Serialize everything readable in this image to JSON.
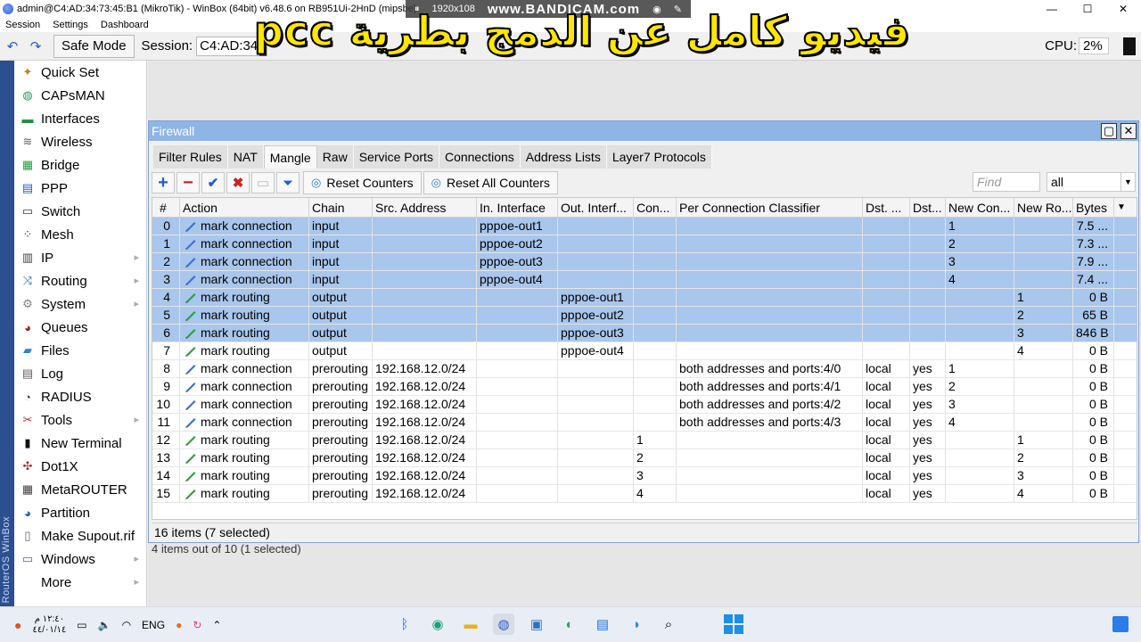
{
  "window": {
    "title": "admin@C4:AD:34:73:45:B1 (MikroTik) - WinBox (64bit) v6.48.6 on RB951Ui-2HnD (mipsbe)",
    "recorder_res": "1920x108",
    "recorder_brand": "www.BANDICAM.com",
    "controls": [
      "—",
      "☐",
      "✕"
    ]
  },
  "menu": [
    "Session",
    "Settings",
    "Dashboard"
  ],
  "toolbar": {
    "safe_mode": "Safe Mode",
    "session_label": "Session:",
    "session_value": "C4:AD:34",
    "cpu_label": "CPU:",
    "cpu_value": "2%"
  },
  "overlay_text": "فيديو كامل عن الدمج بطرية pcc",
  "routeros_label": "RouterOS WinBox",
  "sidebar": [
    {
      "label": "Quick Set",
      "icon": "wand-icon"
    },
    {
      "label": "CAPsMAN",
      "icon": "capsman-icon"
    },
    {
      "label": "Interfaces",
      "icon": "interfaces-icon"
    },
    {
      "label": "Wireless",
      "icon": "wireless-icon"
    },
    {
      "label": "Bridge",
      "icon": "bridge-icon"
    },
    {
      "label": "PPP",
      "icon": "ppp-icon"
    },
    {
      "label": "Switch",
      "icon": "switch-icon"
    },
    {
      "label": "Mesh",
      "icon": "mesh-icon"
    },
    {
      "label": "IP",
      "icon": "ip-icon",
      "submenu": true
    },
    {
      "label": "Routing",
      "icon": "routing-icon",
      "submenu": true
    },
    {
      "label": "System",
      "icon": "gear-icon",
      "submenu": true
    },
    {
      "label": "Queues",
      "icon": "queues-icon"
    },
    {
      "label": "Files",
      "icon": "folder-icon"
    },
    {
      "label": "Log",
      "icon": "log-icon"
    },
    {
      "label": "RADIUS",
      "icon": "radius-icon"
    },
    {
      "label": "Tools",
      "icon": "tools-icon",
      "submenu": true
    },
    {
      "label": "New Terminal",
      "icon": "terminal-icon"
    },
    {
      "label": "Dot1X",
      "icon": "dot1x-icon"
    },
    {
      "label": "MetaROUTER",
      "icon": "metarouter-icon"
    },
    {
      "label": "Partition",
      "icon": "partition-icon"
    },
    {
      "label": "Make Supout.rif",
      "icon": "supout-icon"
    },
    {
      "label": "Windows",
      "icon": "windows-icon",
      "submenu": true
    },
    {
      "label": "More",
      "icon": "",
      "submenu": true
    }
  ],
  "firewall": {
    "title": "Firewall",
    "tabs": [
      "Filter Rules",
      "NAT",
      "Mangle",
      "Raw",
      "Service Ports",
      "Connections",
      "Address Lists",
      "Layer7 Protocols"
    ],
    "active_tab": "Mangle",
    "reset_counters": "Reset Counters",
    "reset_all_counters": "Reset All Counters",
    "find_placeholder": "Find",
    "filter_value": "all",
    "columns": [
      "#",
      "Action",
      "Chain",
      "Src. Address",
      "In. Interface",
      "Out. Interf...",
      "Con...",
      "Per Connection Classifier",
      "Dst. ...",
      "Dst...",
      "New Con...",
      "New Ro...",
      "Bytes"
    ],
    "rows": [
      {
        "n": "0",
        "action": "mark connection",
        "chain": "input",
        "src": "",
        "in": "pppoe-out1",
        "out": "",
        "con": "",
        "pcc": "",
        "dst1": "",
        "dst2": "",
        "newcon": "1",
        "newro": "",
        "bytes": "7.5 ...",
        "selected": true
      },
      {
        "n": "1",
        "action": "mark connection",
        "chain": "input",
        "src": "",
        "in": "pppoe-out2",
        "out": "",
        "con": "",
        "pcc": "",
        "dst1": "",
        "dst2": "",
        "newcon": "2",
        "newro": "",
        "bytes": "7.3 ...",
        "selected": true
      },
      {
        "n": "2",
        "action": "mark connection",
        "chain": "input",
        "src": "",
        "in": "pppoe-out3",
        "out": "",
        "con": "",
        "pcc": "",
        "dst1": "",
        "dst2": "",
        "newcon": "3",
        "newro": "",
        "bytes": "7.9 ...",
        "selected": true
      },
      {
        "n": "3",
        "action": "mark connection",
        "chain": "input",
        "src": "",
        "in": "pppoe-out4",
        "out": "",
        "con": "",
        "pcc": "",
        "dst1": "",
        "dst2": "",
        "newcon": "4",
        "newro": "",
        "bytes": "7.4 ...",
        "selected": true
      },
      {
        "n": "4",
        "action": "mark routing",
        "chain": "output",
        "src": "",
        "in": "",
        "out": "pppoe-out1",
        "con": "",
        "pcc": "",
        "dst1": "",
        "dst2": "",
        "newcon": "",
        "newro": "1",
        "bytes": "0 B",
        "selected": true
      },
      {
        "n": "5",
        "action": "mark routing",
        "chain": "output",
        "src": "",
        "in": "",
        "out": "pppoe-out2",
        "con": "",
        "pcc": "",
        "dst1": "",
        "dst2": "",
        "newcon": "",
        "newro": "2",
        "bytes": "65 B",
        "selected": true
      },
      {
        "n": "6",
        "action": "mark routing",
        "chain": "output",
        "src": "",
        "in": "",
        "out": "pppoe-out3",
        "con": "",
        "pcc": "",
        "dst1": "",
        "dst2": "",
        "newcon": "",
        "newro": "3",
        "bytes": "846 B",
        "selected": true
      },
      {
        "n": "7",
        "action": "mark routing",
        "chain": "output",
        "src": "",
        "in": "",
        "out": "pppoe-out4",
        "con": "",
        "pcc": "",
        "dst1": "",
        "dst2": "",
        "newcon": "",
        "newro": "4",
        "bytes": "0 B",
        "selected": false
      },
      {
        "n": "8",
        "action": "mark connection",
        "chain": "prerouting",
        "src": "192.168.12.0/24",
        "in": "",
        "out": "",
        "con": "",
        "pcc": "both addresses and ports:4/0",
        "dst1": "local",
        "dst2": "yes",
        "newcon": "1",
        "newro": "",
        "bytes": "0 B",
        "selected": false
      },
      {
        "n": "9",
        "action": "mark connection",
        "chain": "prerouting",
        "src": "192.168.12.0/24",
        "in": "",
        "out": "",
        "con": "",
        "pcc": "both addresses and ports:4/1",
        "dst1": "local",
        "dst2": "yes",
        "newcon": "2",
        "newro": "",
        "bytes": "0 B",
        "selected": false
      },
      {
        "n": "10",
        "action": "mark connection",
        "chain": "prerouting",
        "src": "192.168.12.0/24",
        "in": "",
        "out": "",
        "con": "",
        "pcc": "both addresses and ports:4/2",
        "dst1": "local",
        "dst2": "yes",
        "newcon": "3",
        "newro": "",
        "bytes": "0 B",
        "selected": false
      },
      {
        "n": "11",
        "action": "mark connection",
        "chain": "prerouting",
        "src": "192.168.12.0/24",
        "in": "",
        "out": "",
        "con": "",
        "pcc": "both addresses and ports:4/3",
        "dst1": "local",
        "dst2": "yes",
        "newcon": "4",
        "newro": "",
        "bytes": "0 B",
        "selected": false
      },
      {
        "n": "12",
        "action": "mark routing",
        "chain": "prerouting",
        "src": "192.168.12.0/24",
        "in": "",
        "out": "",
        "con": "1",
        "pcc": "",
        "dst1": "local",
        "dst2": "yes",
        "newcon": "",
        "newro": "1",
        "bytes": "0 B",
        "selected": false
      },
      {
        "n": "13",
        "action": "mark routing",
        "chain": "prerouting",
        "src": "192.168.12.0/24",
        "in": "",
        "out": "",
        "con": "2",
        "pcc": "",
        "dst1": "local",
        "dst2": "yes",
        "newcon": "",
        "newro": "2",
        "bytes": "0 B",
        "selected": false
      },
      {
        "n": "14",
        "action": "mark routing",
        "chain": "prerouting",
        "src": "192.168.12.0/24",
        "in": "",
        "out": "",
        "con": "3",
        "pcc": "",
        "dst1": "local",
        "dst2": "yes",
        "newcon": "",
        "newro": "3",
        "bytes": "0 B",
        "selected": false
      },
      {
        "n": "15",
        "action": "mark routing",
        "chain": "prerouting",
        "src": "192.168.12.0/24",
        "in": "",
        "out": "",
        "con": "4",
        "pcc": "",
        "dst1": "local",
        "dst2": "yes",
        "newcon": "",
        "newro": "4",
        "bytes": "0 B",
        "selected": false
      }
    ],
    "status": "16 items (7 selected)",
    "under_status": "4 items out of 10 (1 selected)"
  },
  "taskbar": {
    "time": "١٢:٤٠ م",
    "date": "٤٤/٠١/١٤",
    "lang": "ENG"
  },
  "colors": {
    "selection": "#a9c6ec",
    "titlebar": "#8fb4e6",
    "overlay": "#ffe600",
    "mark_connection_icon": "#3b6fd4",
    "mark_routing_icon": "#2e9e3a"
  }
}
